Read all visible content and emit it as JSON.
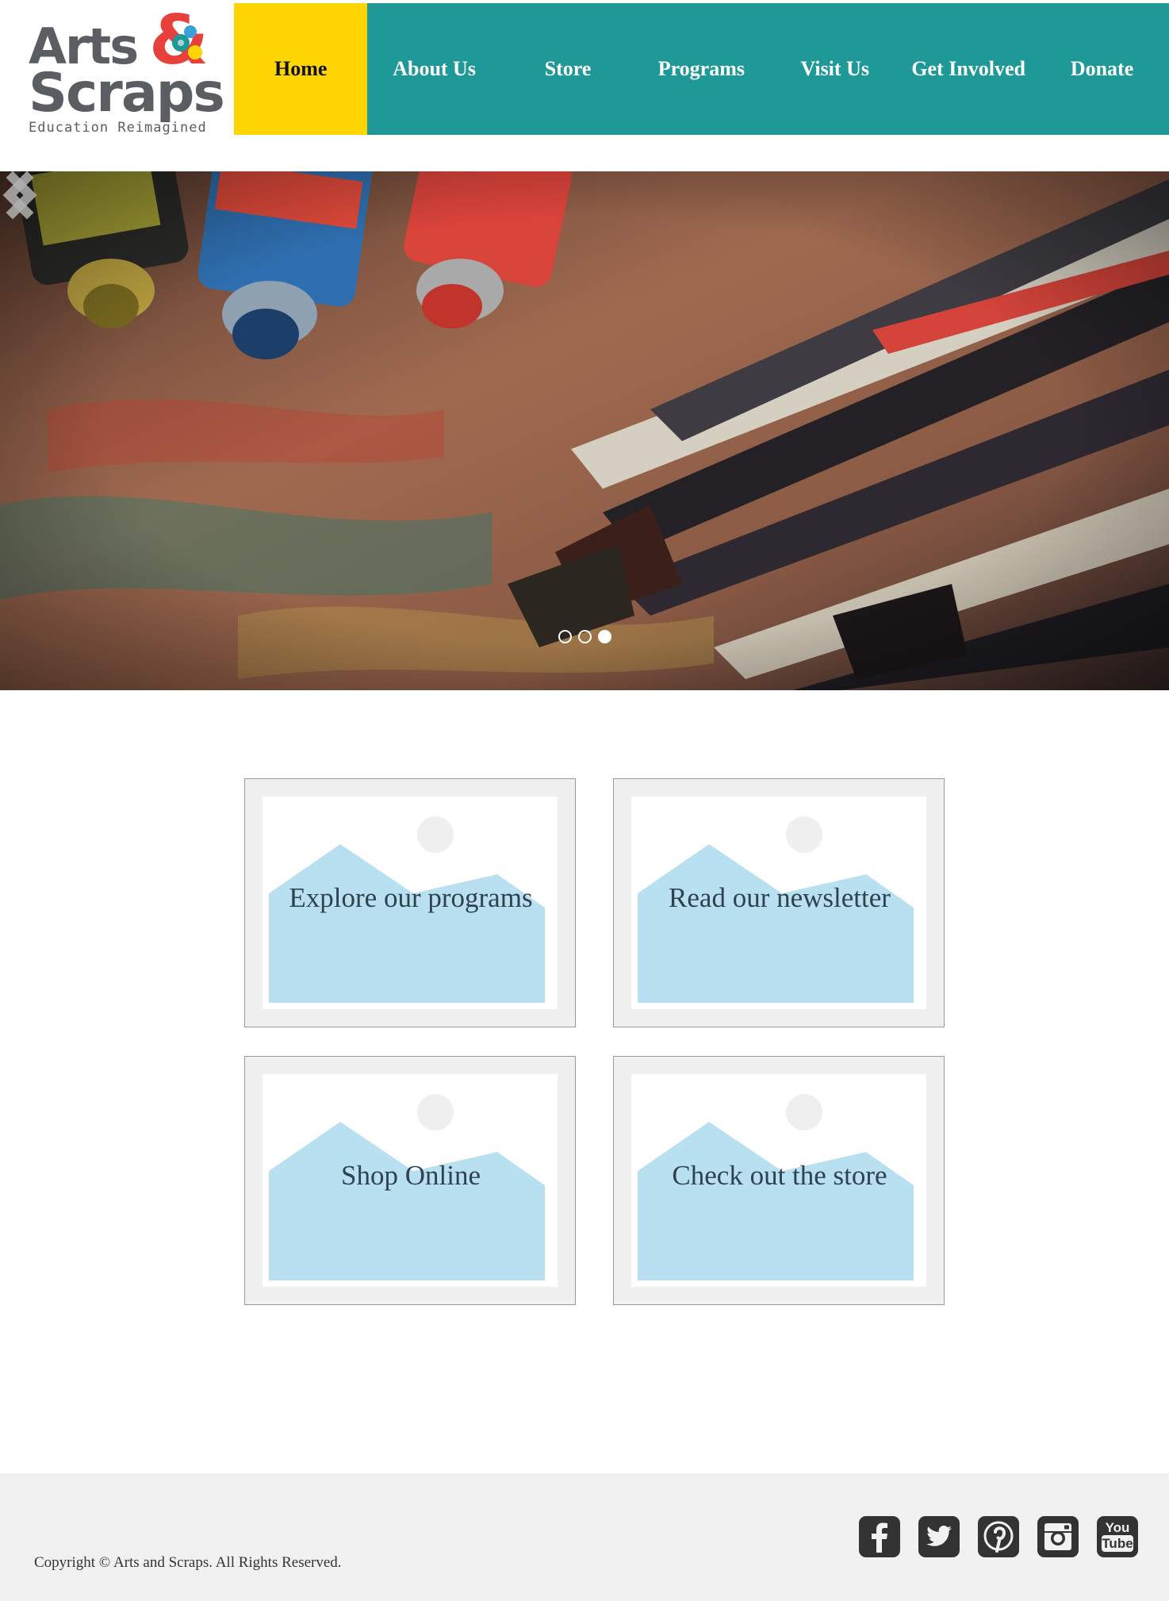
{
  "logo": {
    "line1": "Arts",
    "line2": "Scraps",
    "tagline": "Education Reimagined",
    "ampersand_colors": [
      "#e8413b",
      "#fed500",
      "#1f9898",
      "#3aa0d8"
    ]
  },
  "nav": {
    "items": [
      {
        "label": "Home",
        "active": true
      },
      {
        "label": "About Us"
      },
      {
        "label": "Store"
      },
      {
        "label": "Programs"
      },
      {
        "label": "Visit Us"
      },
      {
        "label": "Get Involved"
      },
      {
        "label": "Donate"
      }
    ],
    "bg_color": "#1f9898",
    "active_color": "#fed500"
  },
  "hero": {
    "slide_count": 3,
    "active_slide": 3,
    "prev_icon": "chevron-left-icon",
    "next_icon": "chevron-right-icon"
  },
  "tiles": [
    {
      "label": "Explore our programs",
      "icon": "image-placeholder-icon"
    },
    {
      "label": "Read our newsletter",
      "icon": "image-placeholder-icon"
    },
    {
      "label": "Shop Online",
      "icon": "image-placeholder-icon"
    },
    {
      "label": "Check out the store",
      "icon": "image-placeholder-icon"
    }
  ],
  "footer": {
    "copyright": "Copyright © Arts and Scraps. All Rights Reserved.",
    "social": [
      {
        "icon": "facebook-icon",
        "glyph": "f"
      },
      {
        "icon": "twitter-icon"
      },
      {
        "icon": "pinterest-icon",
        "glyph": "P"
      },
      {
        "icon": "instagram-icon"
      },
      {
        "icon": "youtube-icon",
        "text_top": "You",
        "text_bottom": "Tube"
      }
    ]
  }
}
